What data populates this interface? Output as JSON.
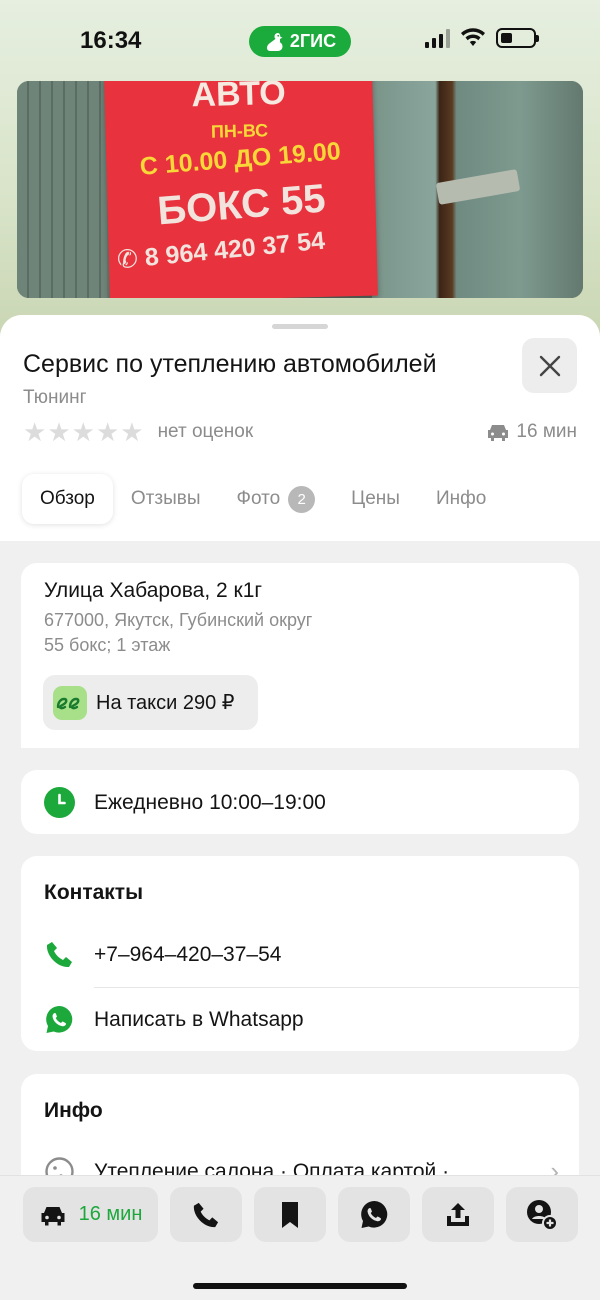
{
  "status_bar": {
    "time": "16:34",
    "brand": "2ГИС",
    "icons": [
      "signal-icon",
      "wifi-icon",
      "battery-icon"
    ]
  },
  "photo": {
    "sign_lines": [
      "АВТО",
      "ПН-ВС",
      "С 10.00 ДО 19.00",
      "БОКС 55",
      "8 964 420 37 54"
    ]
  },
  "place": {
    "title": "Сервис по утеплению автомобилей",
    "category": "Тюнинг",
    "rating_text": "нет оценок",
    "stars_filled": 0,
    "stars_total": 5,
    "drive_time": "16 мин"
  },
  "tabs": [
    {
      "label": "Обзор",
      "active": true
    },
    {
      "label": "Отзывы"
    },
    {
      "label": "Фото",
      "badge": "2"
    },
    {
      "label": "Цены"
    },
    {
      "label": "Инфо"
    }
  ],
  "address": {
    "street": "Улица Хабарова, 2 к1г",
    "city": "677000, Якутск, Губинский округ",
    "detail": "55 бокс; 1 этаж",
    "taxi_label": "На такси 290 ₽"
  },
  "hours": {
    "text": "Ежедневно 10:00–19:00"
  },
  "contacts": {
    "title": "Контакты",
    "phone": "+7‒964‒420‒37‒54",
    "whatsapp": "Написать в Whatsapp"
  },
  "info": {
    "title": "Инфо",
    "features": "Утепление салона · Оплата картой ·"
  },
  "bottom_bar": {
    "route_time": "16 мин",
    "actions": [
      "car-icon",
      "phone-icon",
      "bookmark-icon",
      "whatsapp-icon",
      "share-icon",
      "add-contact-icon"
    ]
  },
  "colors": {
    "accent_green": "#1da83c",
    "brand_green": "#1baa3c",
    "sign_red": "#e8333e",
    "taxi_logo_green": "#a8e08a"
  }
}
